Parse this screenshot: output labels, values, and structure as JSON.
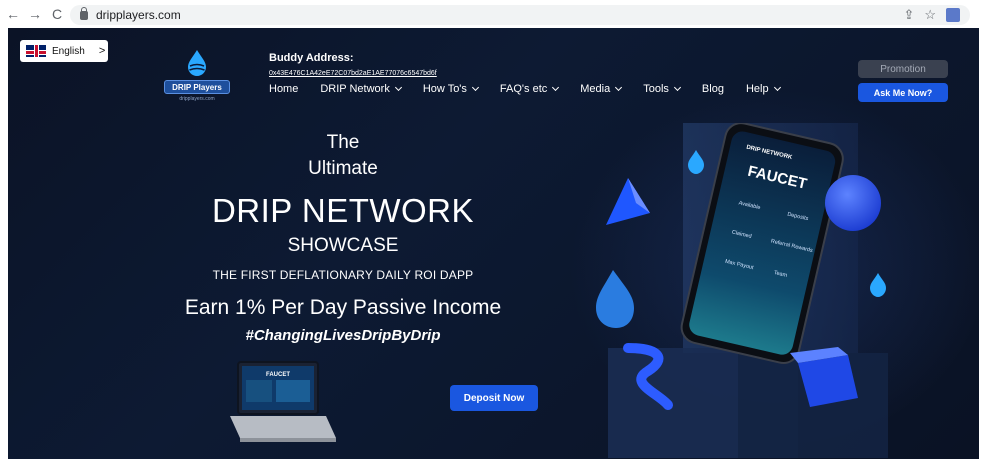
{
  "browser": {
    "url": "dripplayers.com",
    "back": "←",
    "forward": "→",
    "reload": "C"
  },
  "lang": {
    "label": "English",
    "arrow": ">"
  },
  "logo": {
    "badge": "DRIP Players",
    "sub": "dripplayers.com"
  },
  "buddy": {
    "title": "Buddy Address:",
    "address": "0x43E476C1A42eE72C07bd2aE1AE77076c6547bd6f"
  },
  "nav": {
    "home": "Home",
    "drip_network": "DRIP Network",
    "how_tos": "How To's",
    "faqs": "FAQ's etc",
    "media": "Media",
    "tools": "Tools",
    "blog": "Blog",
    "help": "Help"
  },
  "buttons": {
    "promotion": "Promotion",
    "ask": "Ask Me Now?",
    "deposit": "Deposit Now"
  },
  "hero": {
    "the": "The",
    "ultimate": "Ultimate",
    "drip_network": "DRIP NETWORK",
    "showcase": "SHOWCASE",
    "first": "THE FIRST DEFLATIONARY DAILY ROI DAPP",
    "earn": "Earn 1% Per Day Passive Income",
    "tag": "#ChangingLivesDripByDrip"
  },
  "phone": {
    "brand": "DRIP NETWORK",
    "faucet": "FAUCET",
    "labels": [
      "Available",
      "Deposits",
      "Claimed",
      "Referral Rewards",
      "Max Payout",
      "Team"
    ]
  },
  "laptop": {
    "faucet": "FAUCET"
  },
  "colors": {
    "bg": "#0b1326",
    "accent": "#1a57e0",
    "cyan": "#2aa8ff"
  }
}
